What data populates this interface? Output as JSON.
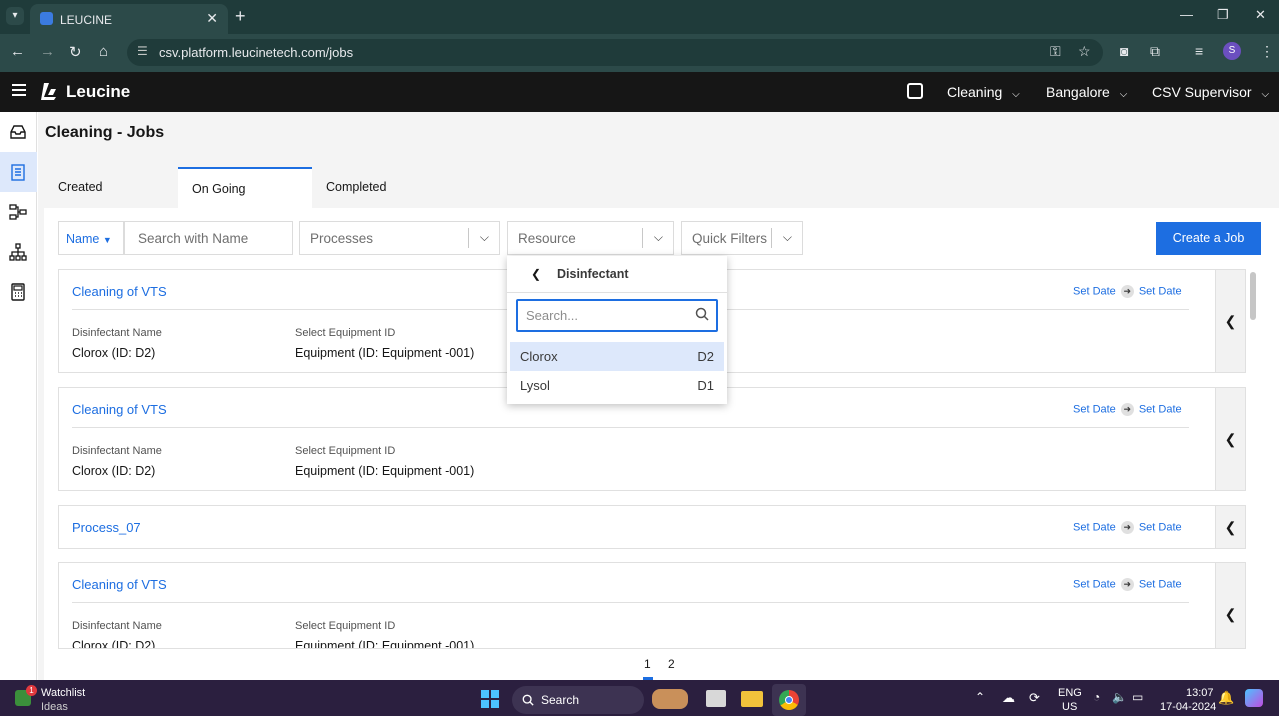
{
  "browser": {
    "tab_title": "LEUCINE",
    "url": "csv.platform.leucinetech.com/jobs",
    "profile_initial": "S"
  },
  "header": {
    "brand": "Leucine",
    "module": "Cleaning",
    "facility": "Bangalore",
    "role": "CSV Supervisor"
  },
  "page": {
    "title": "Cleaning - Jobs",
    "tabs": [
      "Created",
      "On Going",
      "Completed"
    ],
    "active_tab": "On Going"
  },
  "filters": {
    "name_select": "Name",
    "search_placeholder": "Search with Name",
    "processes": "Processes",
    "resource": "Resource",
    "quick_filters": "Quick Filters",
    "create_label": "Create a Job"
  },
  "jobs": [
    {
      "title": "Cleaning of VTS",
      "start": "Set Date",
      "end": "Set Date",
      "fields": [
        {
          "label": "Disinfectant Name",
          "value": "Clorox (ID: D2)"
        },
        {
          "label": "Select Equipment ID",
          "value": "Equipment (ID: Equipment -001)"
        }
      ]
    },
    {
      "title": "Cleaning of VTS",
      "start": "Set Date",
      "end": "Set Date",
      "fields": [
        {
          "label": "Disinfectant Name",
          "value": "Clorox (ID: D2)"
        },
        {
          "label": "Select Equipment ID",
          "value": "Equipment (ID: Equipment -001)"
        }
      ]
    },
    {
      "title": "Process_07",
      "start": "Set Date",
      "end": "Set Date",
      "fields": []
    },
    {
      "title": "Cleaning of VTS",
      "start": "Set Date",
      "end": "Set Date",
      "fields": [
        {
          "label": "Disinfectant Name",
          "value": "Clorox (ID: D2)"
        },
        {
          "label": "Select Equipment ID",
          "value": "Equipment (ID: Equipment -001)"
        }
      ]
    }
  ],
  "pagination": {
    "pages": [
      "1",
      "2"
    ],
    "current": "1"
  },
  "resource_popup": {
    "title": "Disinfectant",
    "search_placeholder": "Search...",
    "options": [
      {
        "name": "Clorox",
        "id": "D2",
        "highlighted": true
      },
      {
        "name": "Lysol",
        "id": "D1",
        "highlighted": false
      }
    ]
  },
  "taskbar": {
    "widget_title": "Watchlist",
    "widget_sub": "Ideas",
    "widget_badge": "1",
    "search_label": "Search",
    "lang_top": "ENG",
    "lang_bottom": "US",
    "time": "13:07",
    "date": "17-04-2024"
  },
  "colors": {
    "accent": "#1d6ee1",
    "header_bg": "#161616",
    "taskbar_bg": "#2b1f3f"
  }
}
